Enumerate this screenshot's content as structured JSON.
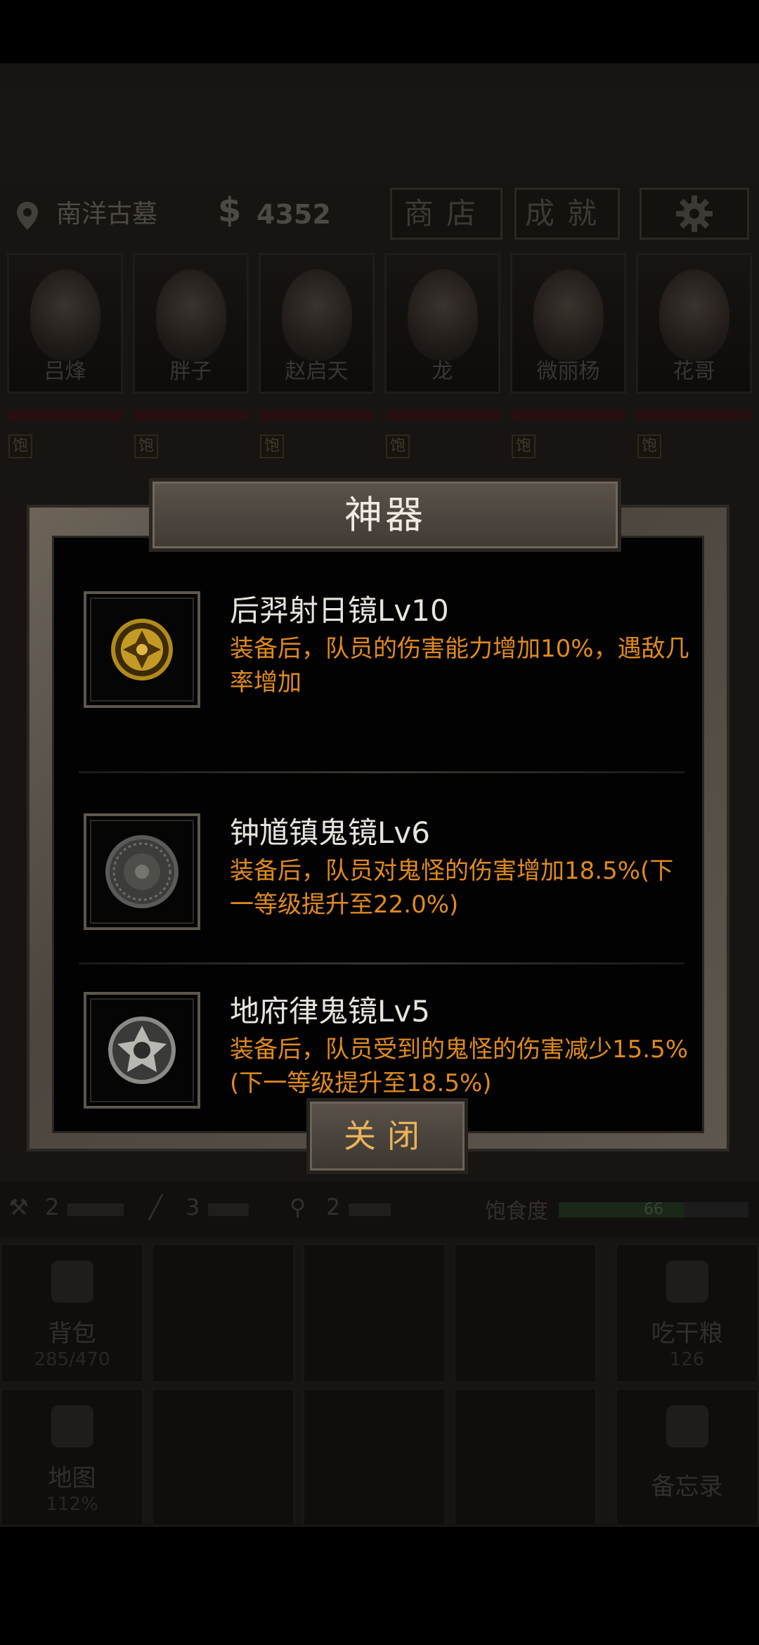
{
  "status_bar": {},
  "topbar": {
    "location": "南洋古墓",
    "money_symbol": "$",
    "money": "4352",
    "shop_label": "商店",
    "achieve_label": "成就"
  },
  "team": [
    {
      "name": "吕烽",
      "status": "饱"
    },
    {
      "name": "胖子",
      "status": "饱"
    },
    {
      "name": "赵启天",
      "status": "饱"
    },
    {
      "name": "龙",
      "status": "饱"
    },
    {
      "name": "微丽杨",
      "status": "饱"
    },
    {
      "name": "花哥",
      "status": "饱"
    }
  ],
  "tools": [
    {
      "icon": "torch-icon",
      "count": "2"
    },
    {
      "icon": "rope-icon",
      "count": "3"
    },
    {
      "icon": "shovel-icon",
      "count": "2"
    }
  ],
  "satiety": {
    "label": "饱食度",
    "value": "66",
    "fraction": 0.66
  },
  "grid": {
    "backpack": {
      "label": "背包",
      "sub": "285/470"
    },
    "eat": {
      "label": "吃干粮",
      "sub": "126"
    },
    "map": {
      "label": "地图",
      "sub": "112%"
    },
    "memo": {
      "label": "备忘录"
    }
  },
  "dialog": {
    "title": "神器",
    "items": [
      {
        "name": "后羿射日镜Lv10",
        "desc": "装备后，队员的伤害能力增加10%，遇敌几率增加",
        "icon": "golden-mirror-icon"
      },
      {
        "name": "钟馗镇鬼镜Lv6",
        "desc": "装备后，队员对鬼怪的伤害增加18.5%(下一等级提升至22.0%)",
        "icon": "bronze-mirror-icon"
      },
      {
        "name": "地府律鬼镜Lv5",
        "desc": "装备后，队员受到的鬼怪的伤害减少15.5%(下一等级提升至18.5%)",
        "icon": "silver-mirror-icon"
      }
    ],
    "close_label": "关闭"
  },
  "colors": {
    "accent_orange": "#e08a1e",
    "close_text": "#e9b35a",
    "hp_red": "#4a1c1c"
  }
}
